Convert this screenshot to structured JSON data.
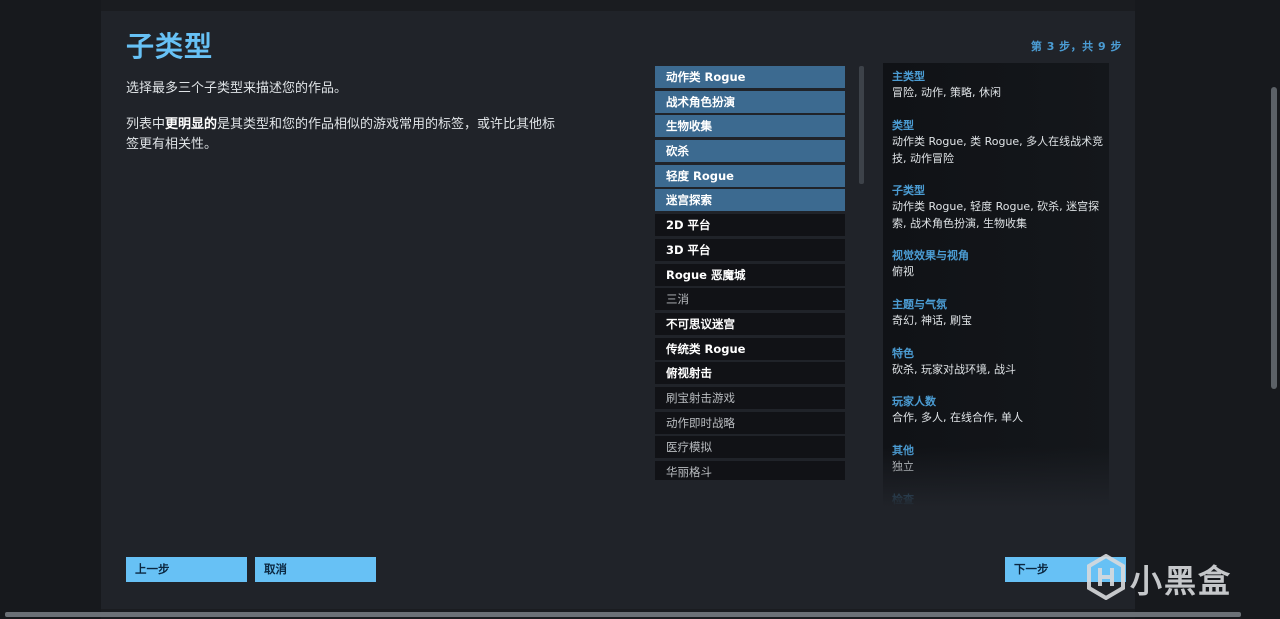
{
  "header": {
    "title": "子类型",
    "step": "第 3 步，共 9 步"
  },
  "description": {
    "line1": "选择最多三个子类型来描述您的作品。",
    "line2_before": "列表中",
    "line2_bold": "更明显的",
    "line2_after": "是其类型和您的作品相似的游戏常用的标签，或许比其他标签更有相关性。"
  },
  "tags": [
    {
      "label": "动作类 Rogue",
      "state": "selected"
    },
    {
      "label": "战术角色扮演",
      "state": "selected"
    },
    {
      "label": "生物收集",
      "state": "selected"
    },
    {
      "label": "砍杀",
      "state": "selected"
    },
    {
      "label": "轻度 Rogue",
      "state": "selected"
    },
    {
      "label": "迷宫探索",
      "state": "selected"
    },
    {
      "label": "2D 平台",
      "state": "bold"
    },
    {
      "label": "3D 平台",
      "state": "bold"
    },
    {
      "label": "Rogue 恶魔城",
      "state": "bold"
    },
    {
      "label": "三消",
      "state": "dim"
    },
    {
      "label": "不可思议迷宫",
      "state": "bold"
    },
    {
      "label": "传统类 Rogue",
      "state": "bold"
    },
    {
      "label": "俯视射击",
      "state": "bold"
    },
    {
      "label": "刷宝射击游戏",
      "state": "dim"
    },
    {
      "label": "动作即时战略",
      "state": "dim"
    },
    {
      "label": "医疗模拟",
      "state": "dim"
    },
    {
      "label": "华丽格斗",
      "state": "dim"
    }
  ],
  "summary": {
    "main_type": {
      "head": "主类型",
      "body": "冒险, 动作, 策略, 休闲"
    },
    "genre": {
      "head": "类型",
      "body": "动作类 Rogue, 类 Rogue, 多人在线战术竞技, 动作冒险"
    },
    "subgenre": {
      "head": "子类型",
      "body": "动作类 Rogue, 轻度 Rogue, 砍杀, 迷宫探索, 战术角色扮演, 生物收集"
    },
    "visual": {
      "head": "视觉效果与视角",
      "body": "俯视"
    },
    "theme": {
      "head": "主题与气氛",
      "body": "奇幻, 神话, 刷宝"
    },
    "features": {
      "head": "特色",
      "body": "砍杀, 玩家对战环境, 战斗"
    },
    "players": {
      "head": "玩家人数",
      "body": "合作, 多人, 在线合作, 单人"
    },
    "other": {
      "head": "其他",
      "body": "独立"
    },
    "review": {
      "head": "检查"
    }
  },
  "buttons": {
    "prev": "上一步",
    "cancel": "取消",
    "next": "下一步"
  },
  "watermark": {
    "text": "小黑盒",
    "logo_icon": "heybox-logo-icon"
  }
}
